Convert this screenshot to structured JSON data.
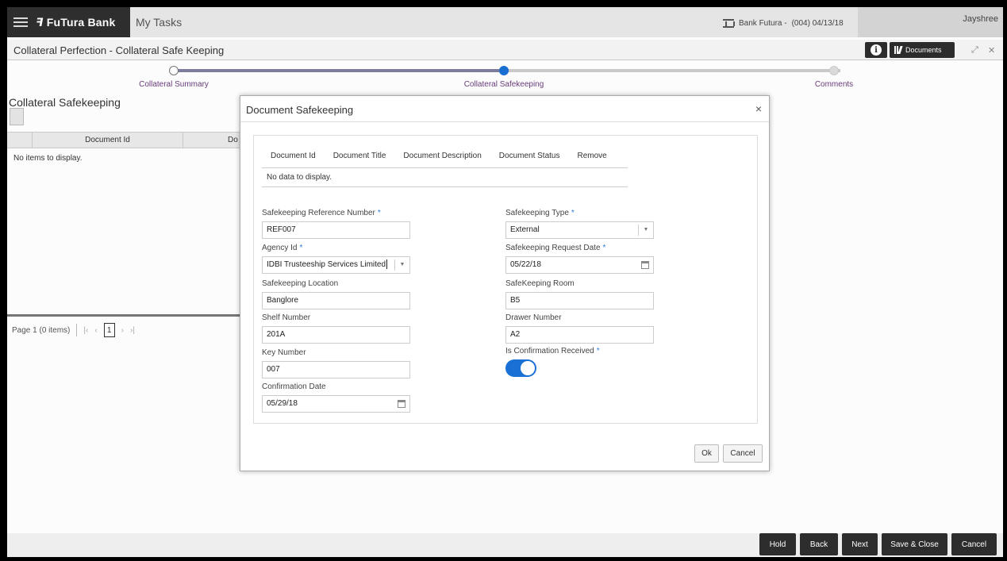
{
  "app": {
    "brand": "FuTura Bank",
    "title": "My Tasks"
  },
  "header": {
    "bank_name": "Bank Futura -",
    "branch_date": "(004)  04/13/18",
    "user": "Jayshree"
  },
  "titlebar": {
    "title": "Collateral Perfection - Collateral Safe Keeping",
    "documents_label": "Documents",
    "info_icon": "info-icon"
  },
  "steps": [
    {
      "label": "Collateral Summary",
      "state": "done"
    },
    {
      "label": "Collateral Safekeeping",
      "state": "active"
    },
    {
      "label": "Comments",
      "state": "pending"
    }
  ],
  "background": {
    "section_title": "Collateral Safekeeping",
    "columns": [
      "Document Id",
      "Do"
    ],
    "empty_text": "No items to display.",
    "pager": {
      "page_label": "Page",
      "page": "1",
      "items": "(0 items)"
    }
  },
  "modal": {
    "title": "Document Safekeeping",
    "table": {
      "columns": [
        "Document Id",
        "Document Title",
        "Document Description",
        "Document Status",
        "Remove"
      ],
      "empty_text": "No data to display."
    },
    "fields": {
      "ref_number": {
        "label": "Safekeeping Reference Number",
        "value": "REF007",
        "required": true
      },
      "type": {
        "label": "Safekeeping Type",
        "value": "External",
        "required": true
      },
      "agency": {
        "label": "Agency Id",
        "value": "IDBI Trusteeship Services Limited",
        "required": true
      },
      "request_date": {
        "label": "Safekeeping Request Date",
        "value": "05/22/18",
        "required": true
      },
      "location": {
        "label": "Safekeeping Location",
        "value": "Banglore"
      },
      "room": {
        "label": "SafeKeeping Room",
        "value": "B5"
      },
      "shelf": {
        "label": "Shelf Number",
        "value": "201A"
      },
      "drawer": {
        "label": "Drawer Number",
        "value": "A2"
      },
      "key": {
        "label": "Key Number",
        "value": "007"
      },
      "confirmation_received": {
        "label": "Is Confirmation Received",
        "value": true,
        "required": true
      },
      "confirmation_date": {
        "label": "Confirmation Date",
        "value": "05/29/18"
      }
    },
    "ok_label": "Ok",
    "cancel_label": "Cancel",
    "required_mark": "*"
  },
  "footer": {
    "hold": "Hold",
    "back": "Back",
    "next": "Next",
    "save_close": "Save & Close",
    "cancel": "Cancel"
  },
  "colors": {
    "accent": "#1a70d4",
    "dark": "#2d2d2d",
    "step_label": "#6a3d7c"
  }
}
